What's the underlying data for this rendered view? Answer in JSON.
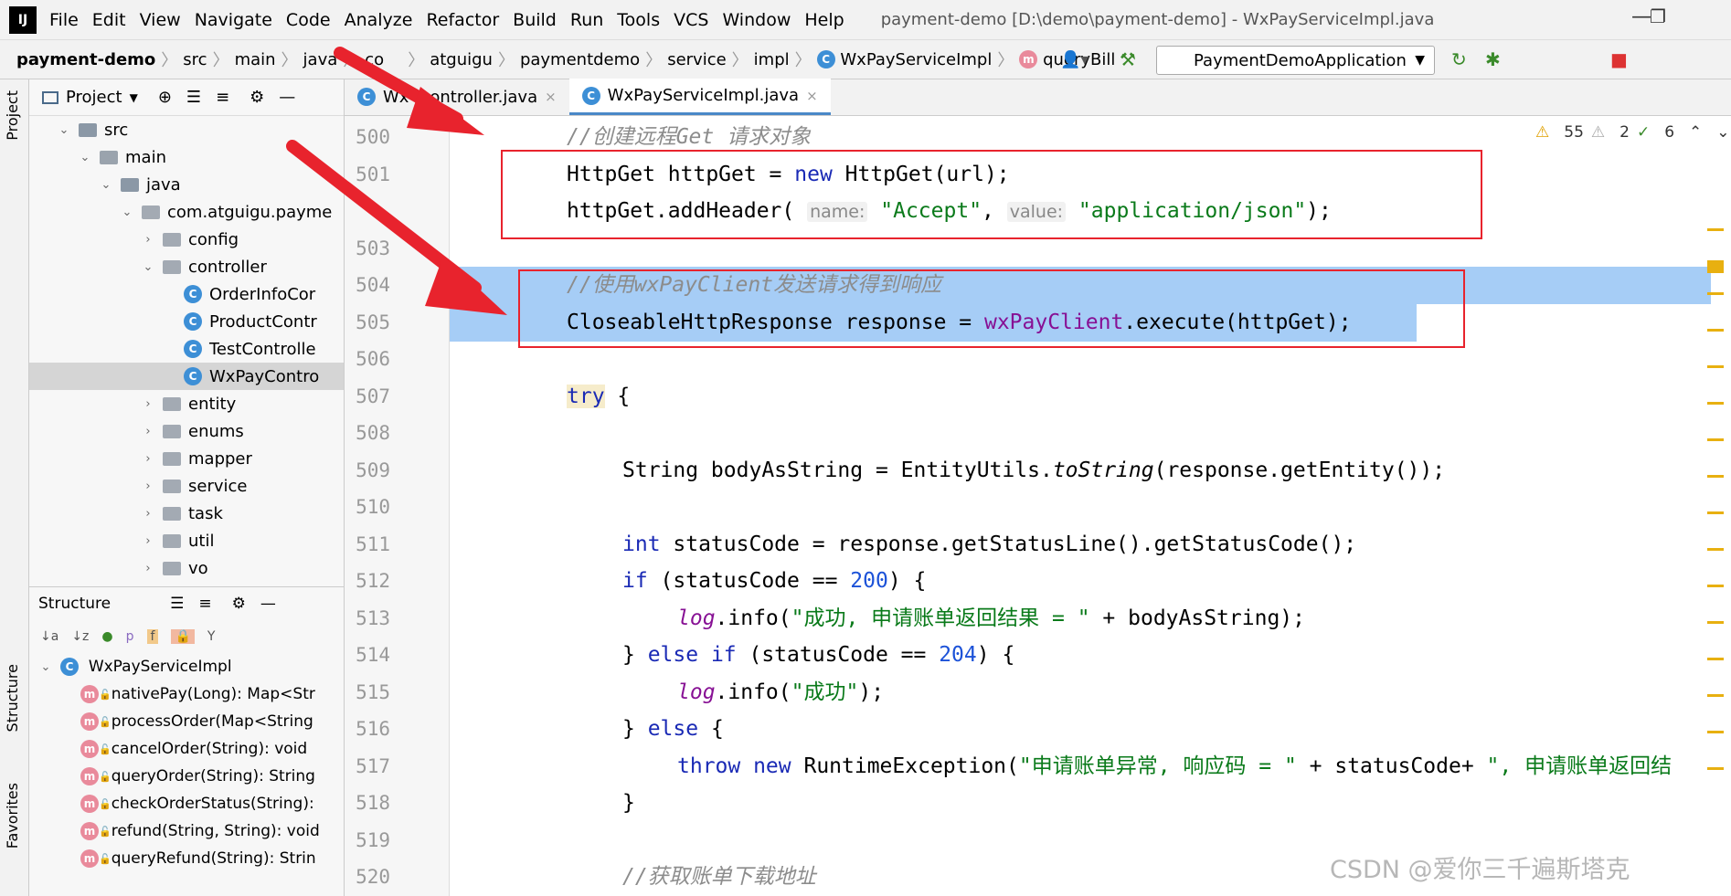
{
  "app": {
    "logo": "IJ",
    "menu": [
      "File",
      "Edit",
      "View",
      "Navigate",
      "Code",
      "Analyze",
      "Refactor",
      "Build",
      "Run",
      "Tools",
      "VCS",
      "Window",
      "Help"
    ],
    "title": "payment-demo [D:\\demo\\payment-demo] - WxPayServiceImpl.java"
  },
  "breadcrumb": [
    "payment-demo",
    "src",
    "main",
    "java",
    "co",
    "atguigu",
    "paymentdemo",
    "service",
    "impl",
    "WxPayServiceImpl",
    "queryBill"
  ],
  "run_config": "PaymentDemoApplication",
  "project": {
    "header": "Project",
    "tree": [
      {
        "label": "src",
        "depth": 0,
        "arrow": "⌄",
        "type": "src"
      },
      {
        "label": "main",
        "depth": 1,
        "arrow": "⌄",
        "type": "folder"
      },
      {
        "label": "java",
        "depth": 2,
        "arrow": "⌄",
        "type": "src"
      },
      {
        "label": "com.atguigu.payme",
        "depth": 3,
        "arrow": "⌄",
        "type": "pkg"
      },
      {
        "label": "config",
        "depth": 4,
        "arrow": "›",
        "type": "pkg"
      },
      {
        "label": "controller",
        "depth": 4,
        "arrow": "⌄",
        "type": "pkg"
      },
      {
        "label": "OrderInfoCor",
        "depth": 5,
        "arrow": "",
        "type": "class"
      },
      {
        "label": "ProductContr",
        "depth": 5,
        "arrow": "",
        "type": "class"
      },
      {
        "label": "TestControlle",
        "depth": 5,
        "arrow": "",
        "type": "class"
      },
      {
        "label": "WxPayContro",
        "depth": 5,
        "arrow": "",
        "type": "class",
        "selected": true
      },
      {
        "label": "entity",
        "depth": 4,
        "arrow": "›",
        "type": "pkg"
      },
      {
        "label": "enums",
        "depth": 4,
        "arrow": "›",
        "type": "pkg"
      },
      {
        "label": "mapper",
        "depth": 4,
        "arrow": "›",
        "type": "pkg"
      },
      {
        "label": "service",
        "depth": 4,
        "arrow": "›",
        "type": "pkg"
      },
      {
        "label": "task",
        "depth": 4,
        "arrow": "›",
        "type": "pkg"
      },
      {
        "label": "util",
        "depth": 4,
        "arrow": "›",
        "type": "pkg"
      },
      {
        "label": "vo",
        "depth": 4,
        "arrow": "›",
        "type": "pkg"
      }
    ]
  },
  "structure": {
    "header": "Structure",
    "root": "WxPayServiceImpl",
    "methods": [
      "nativePay(Long): Map<Str",
      "processOrder(Map<String",
      "cancelOrder(String): void",
      "queryOrder(String): String",
      "checkOrderStatus(String):",
      "refund(String, String): void",
      "queryRefund(String): Strin"
    ]
  },
  "side_tabs": {
    "project": "Project",
    "structure": "Structure",
    "favorites": "Favorites"
  },
  "tabs": [
    {
      "label": "WxPayController.java",
      "display": "Wx    ontroller.java",
      "active": false
    },
    {
      "label": "WxPayServiceImpl.java",
      "display": "WxPayServiceImpl.java",
      "active": true
    }
  ],
  "inspections": {
    "warnings": "55",
    "weak": "2",
    "ok": "6"
  },
  "line_numbers": [
    "500",
    "501",
    "503",
    "504",
    "505",
    "506",
    "507",
    "508",
    "509",
    "510",
    "511",
    "512",
    "513",
    "514",
    "515",
    "516",
    "517",
    "518",
    "519",
    "520"
  ],
  "code": {
    "l500": "//创建远程Get 请求对象",
    "l501a": "HttpGet httpGet = ",
    "l501b": "new",
    "l501c": " HttpGet(url);",
    "l502a": "httpGet.addHeader(",
    "l502h1": "name:",
    "l502s1": "\"Accept\"",
    "l502c": ", ",
    "l502h2": "value:",
    "l502s2": "\"application/json\"",
    "l502d": ");",
    "l504": "//使用wxPayClient发送请求得到响应",
    "l505a": "CloseableHttpResponse response = ",
    "l505b": "wxPayClient",
    "l505c": ".execute(httpGet);",
    "l507a": "try",
    "l507b": " {",
    "l509a": "String bodyAsString = EntityUtils.",
    "l509b": "toString",
    "l509c": "(response.getEntity());",
    "l511a": "int",
    "l511b": " statusCode = response.getStatusLine().getStatusCode();",
    "l512a": "if",
    "l512b": " (statusCode == ",
    "l512c": "200",
    "l512d": ") {",
    "l513a": "log",
    "l513b": ".info(",
    "l513c": "\"成功, 申请账单返回结果 = \"",
    "l513d": " + bodyAsString);",
    "l514a": "} ",
    "l514b": "else if",
    "l514c": " (statusCode == ",
    "l514d": "204",
    "l514e": ") {",
    "l515a": "log",
    "l515b": ".info(",
    "l515c": "\"成功\"",
    "l515d": ");",
    "l516a": "} ",
    "l516b": "else",
    "l516c": " {",
    "l517a": "throw new",
    "l517b": " RuntimeException(",
    "l517c": "\"申请账单异常, 响应码 = \"",
    "l517d": " + statusCode+ ",
    "l517e": "\", 申请账单返回结",
    "l518": "}",
    "l520": "//获取账单下载地址"
  },
  "watermark": "CSDN @爱你三千遍斯塔克",
  "colors": {
    "annotation_red": "#e8232d",
    "selection": "#a6cdf6",
    "keyword": "#1a2ab5",
    "string": "#0a7a1a"
  }
}
